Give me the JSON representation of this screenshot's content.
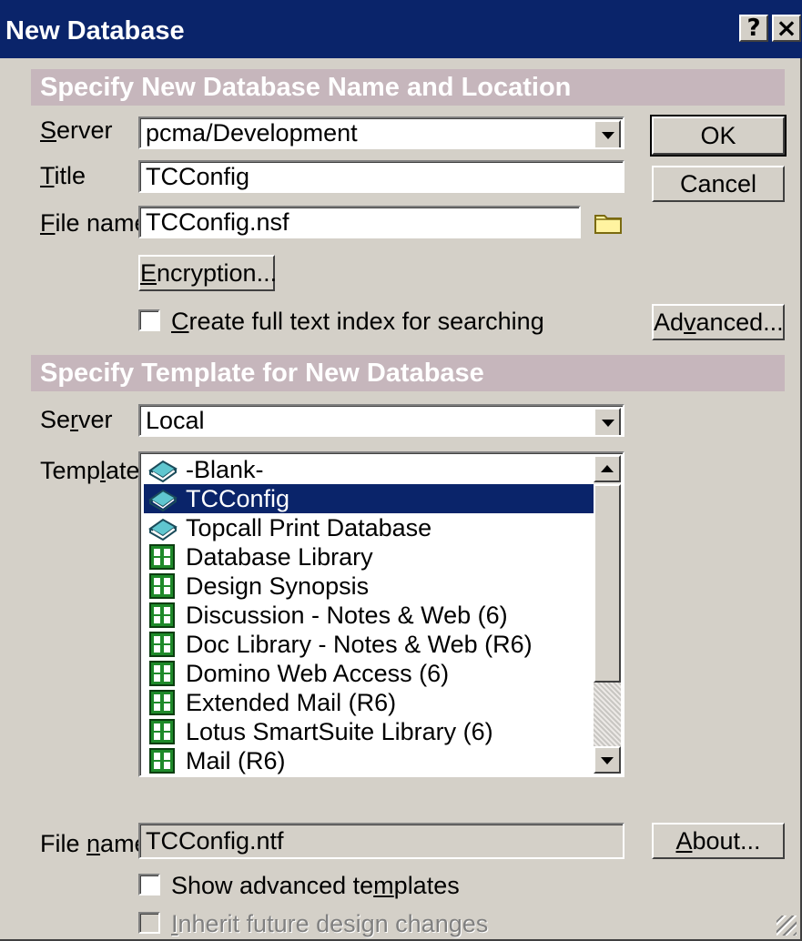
{
  "window": {
    "title": "New Database",
    "help_label": "?",
    "close_label": "×"
  },
  "section1": {
    "heading": "Specify New Database Name and Location",
    "server_label": "Server",
    "server_value": "pcma/Development",
    "title_label": "Title",
    "title_value": "TCConfig",
    "filename_label": "File name",
    "filename_value": "TCConfig.nsf",
    "encryption_label": "Encryption...",
    "fulltext_label": "Create full text index for searching",
    "fulltext_checked": false
  },
  "buttons": {
    "ok": "OK",
    "cancel": "Cancel",
    "advanced": "Advanced...",
    "about": "About..."
  },
  "section2": {
    "heading": "Specify Template for New Database",
    "server_label": "Server",
    "server_value": "Local",
    "template_label": "Template",
    "templates": [
      {
        "label": "-Blank-",
        "icon": "book-icon",
        "selected": false
      },
      {
        "label": "TCConfig",
        "icon": "book-icon",
        "selected": true
      },
      {
        "label": "Topcall Print Database",
        "icon": "book-icon",
        "selected": false
      },
      {
        "label": "Database Library",
        "icon": "domino-template-icon",
        "selected": false
      },
      {
        "label": "Design Synopsis",
        "icon": "domino-template-icon",
        "selected": false
      },
      {
        "label": "Discussion - Notes & Web (6)",
        "icon": "domino-template-icon",
        "selected": false
      },
      {
        "label": "Doc Library - Notes & Web (R6)",
        "icon": "domino-template-icon",
        "selected": false
      },
      {
        "label": "Domino Web Access (6)",
        "icon": "domino-template-icon",
        "selected": false
      },
      {
        "label": "Extended Mail (R6)",
        "icon": "domino-template-icon",
        "selected": false
      },
      {
        "label": "Lotus SmartSuite Library (6)",
        "icon": "domino-template-icon",
        "selected": false
      },
      {
        "label": "Mail (R6)",
        "icon": "domino-template-icon",
        "selected": false
      }
    ],
    "filename_label": "File name",
    "filename_value": "TCConfig.ntf",
    "show_advanced_label": "Show advanced templates",
    "show_advanced_checked": false,
    "inherit_label": "Inherit future design changes",
    "inherit_checked": false
  },
  "colors": {
    "titlebar": "#0a246a",
    "band": "#c6b6bc",
    "face": "#d4d0c8",
    "selection": "#0a246a",
    "book_icon": "#5fc6cf",
    "template_icon": "#1f8a2a"
  }
}
